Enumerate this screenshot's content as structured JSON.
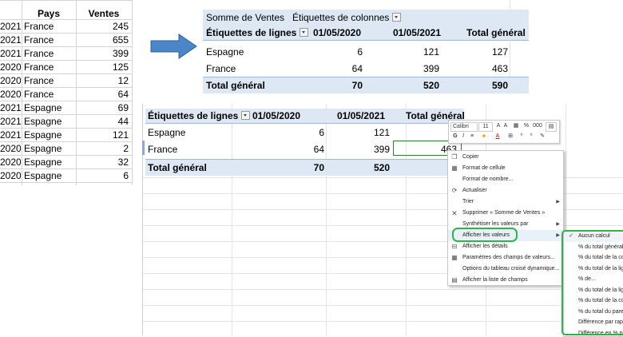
{
  "colors": {
    "accent_green": "#2fb34a",
    "arrow_blue": "#4a86c8",
    "pivot_header": "#dde8f4"
  },
  "source_table": {
    "headers": [
      "Pays",
      "Ventes"
    ],
    "rows": [
      {
        "year": "2021",
        "country": "France",
        "sales": "245"
      },
      {
        "year": "2021",
        "country": "France",
        "sales": "655"
      },
      {
        "year": "2021",
        "country": "France",
        "sales": "399"
      },
      {
        "year": "2020",
        "country": "France",
        "sales": "125"
      },
      {
        "year": "2020",
        "country": "France",
        "sales": "12"
      },
      {
        "year": "2020",
        "country": "France",
        "sales": "64"
      },
      {
        "year": "2021",
        "country": "Espagne",
        "sales": "69"
      },
      {
        "year": "2021",
        "country": "Espagne",
        "sales": "44"
      },
      {
        "year": "2021",
        "country": "Espagne",
        "sales": "121"
      },
      {
        "year": "2020",
        "country": "Espagne",
        "sales": "2"
      },
      {
        "year": "2020",
        "country": "Espagne",
        "sales": "32"
      },
      {
        "year": "2020",
        "country": "Espagne",
        "sales": "6"
      }
    ]
  },
  "pivot1": {
    "sum_label": "Somme de Ventes",
    "col_labels": "Étiquettes de colonnes",
    "row_labels": "Étiquettes de lignes",
    "col1": "01/05/2020",
    "col2": "01/05/2021",
    "total": "Total général",
    "rows": [
      {
        "label": "Espagne",
        "v1": "6",
        "v2": "121",
        "t": "127"
      },
      {
        "label": "France",
        "v1": "64",
        "v2": "399",
        "t": "463"
      }
    ],
    "grand": {
      "label": "Total général",
      "v1": "70",
      "v2": "520",
      "t": "590"
    }
  },
  "pivot2": {
    "row_labels": "Étiquettes de lignes",
    "col1": "01/05/2020",
    "col2": "01/05/2021",
    "total": "Total général",
    "rows": [
      {
        "label": "Espagne",
        "v1": "6",
        "v2": "121"
      },
      {
        "label": "France",
        "v1": "64",
        "v2": "399",
        "t": "463"
      }
    ],
    "grand": {
      "label": "Total général",
      "v1": "70",
      "v2": "520"
    }
  },
  "mini_toolbar": {
    "font": "Calibri",
    "size": "11",
    "pct": "%",
    "thousands": "000"
  },
  "context_menu": {
    "copy": "Copier",
    "format_cell": "Format de cellule",
    "number_format": "Format de nombre...",
    "refresh": "Actualiser",
    "sort": "Trier",
    "remove": "Supprimer « Somme de Ventes »",
    "summarize": "Synthétiser les valeurs par",
    "show_values": "Afficher les valeurs",
    "details": "Afficher les détails",
    "field_settings": "Paramètres des champs de valeurs...",
    "pivot_options": "Options du tableau croisé dynamique...",
    "field_list": "Afficher la liste de champs"
  },
  "submenu": {
    "items": [
      "Aucun calcul",
      "% du total général",
      "% du total de la colo",
      "% du total de la ligne",
      "% de...",
      "% du total de la ligne",
      "% du total de la colo",
      "% du total du parent",
      "Différence par rappo",
      "Différence en % par"
    ]
  }
}
